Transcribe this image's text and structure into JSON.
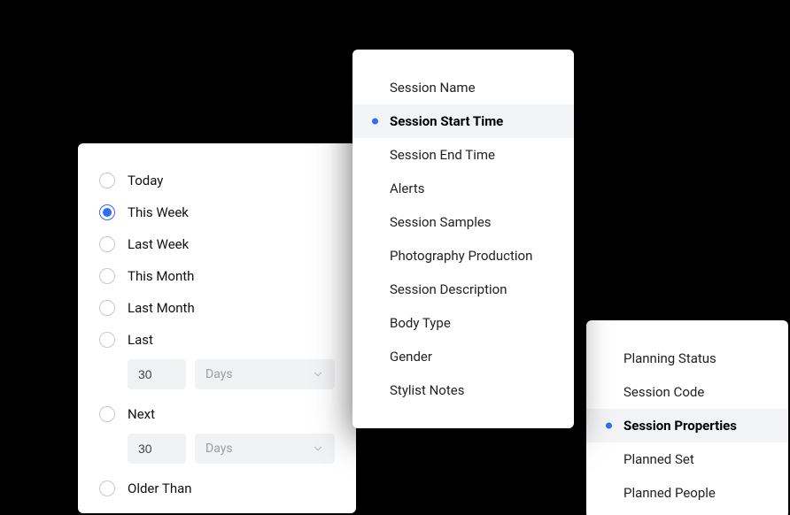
{
  "panelA": {
    "options": [
      {
        "label": "Today",
        "selected": false
      },
      {
        "label": "This Week",
        "selected": true
      },
      {
        "label": "Last Week",
        "selected": false
      },
      {
        "label": "This Month",
        "selected": false
      },
      {
        "label": "Last Month",
        "selected": false
      },
      {
        "label": "Last",
        "selected": false,
        "input": {
          "value": "30",
          "unit": "Days"
        }
      },
      {
        "label": "Next",
        "selected": false,
        "input": {
          "value": "30",
          "unit": "Days"
        }
      },
      {
        "label": "Older Than",
        "selected": false
      }
    ]
  },
  "panelB": {
    "items": [
      {
        "label": "Session Name",
        "selected": false
      },
      {
        "label": "Session Start Time",
        "selected": true
      },
      {
        "label": "Session End Time",
        "selected": false
      },
      {
        "label": "Alerts",
        "selected": false
      },
      {
        "label": "Session Samples",
        "selected": false
      },
      {
        "label": "Photography Production",
        "selected": false
      },
      {
        "label": "Session Description",
        "selected": false
      },
      {
        "label": "Body Type",
        "selected": false
      },
      {
        "label": "Gender",
        "selected": false
      },
      {
        "label": "Stylist Notes",
        "selected": false
      }
    ]
  },
  "panelC": {
    "items": [
      {
        "label": "Planning Status",
        "selected": false
      },
      {
        "label": "Session Code",
        "selected": false
      },
      {
        "label": "Session Properties",
        "selected": true
      },
      {
        "label": "Planned Set",
        "selected": false
      },
      {
        "label": "Planned People",
        "selected": false
      }
    ]
  }
}
